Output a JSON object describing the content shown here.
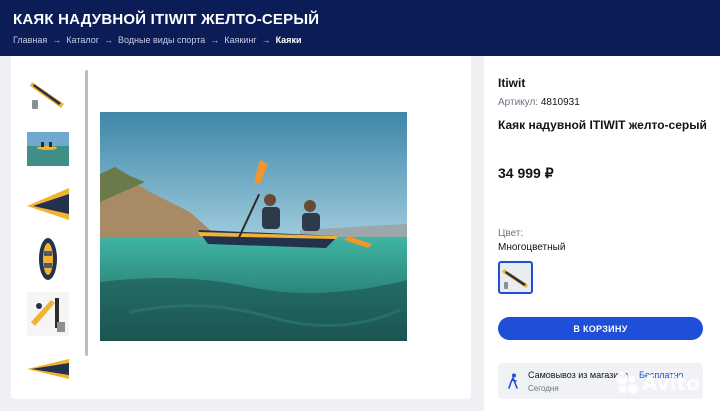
{
  "header": {
    "title": "КАЯК НАДУВНОЙ ITIWIT ЖЕЛТО-СЕРЫЙ",
    "breadcrumbs": [
      "Главная",
      "Каталог",
      "Водные виды спорта",
      "Каякинг",
      "Каяки"
    ]
  },
  "gallery": {
    "thumbnails": [
      {
        "icon": "kayak-yellow-icon"
      },
      {
        "icon": "kayak-lake-photo-icon"
      },
      {
        "icon": "kayak-front-icon"
      },
      {
        "icon": "kayak-top-view-icon"
      },
      {
        "icon": "kayak-accessories-icon"
      },
      {
        "icon": "kayak-partial-icon"
      }
    ],
    "main_image": "kayak-two-paddlers-photo"
  },
  "product": {
    "brand": "Itiwit",
    "article_label": "Артикул:",
    "article_number": "4810931",
    "name": "Каяк надувной ITIWIT желто-серый",
    "price": "34 999 ₽",
    "color_label": "Цвет:",
    "color_value": "Многоцветный",
    "cart_button": "В КОРЗИНУ",
    "pickup": {
      "title": "Самовывоз из магазина",
      "cost": "Бесплатно",
      "when": "Сегодня"
    }
  },
  "watermark": "Avito",
  "colors": {
    "header_bg": "#0c1c56",
    "accent": "#1f4fd8",
    "kayak_yellow": "#f2b233",
    "kayak_navy": "#23314d"
  }
}
